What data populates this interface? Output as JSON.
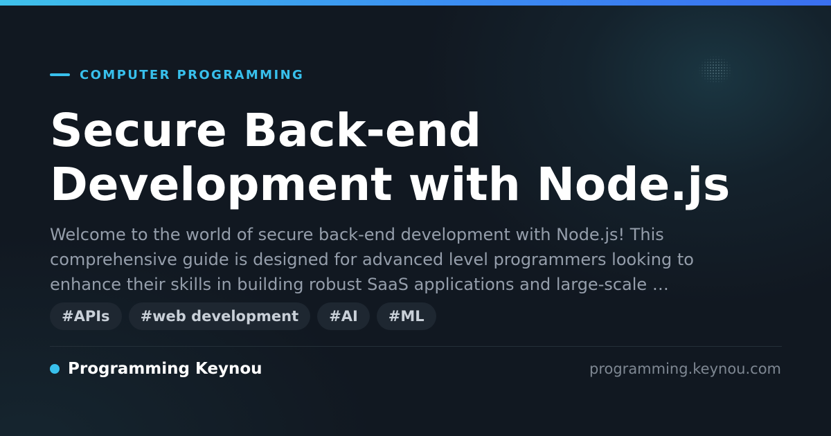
{
  "category": "COMPUTER PROGRAMMING",
  "title": {
    "lines": [
      "Secure Back-end",
      "Development with Node.js"
    ]
  },
  "description": {
    "lines": [
      "Welcome to the world of secure back-end development with Node.js! This",
      "comprehensive guide is designed for advanced level programmers looking to",
      "enhance their skills in building robust SaaS applications and large-scale …"
    ]
  },
  "tags": [
    "#APIs",
    "#web development",
    "#AI",
    "#ML"
  ],
  "footer": {
    "brand": "Programming Keynou",
    "url": "programming.keynou.com"
  },
  "colors": {
    "accent": "#38c0ec",
    "background": "#111821",
    "title": "#ffffff",
    "description": "#959eab",
    "tag_bg": "#1e2731",
    "tag_text": "#c9d0d8",
    "url": "#7e8792"
  }
}
